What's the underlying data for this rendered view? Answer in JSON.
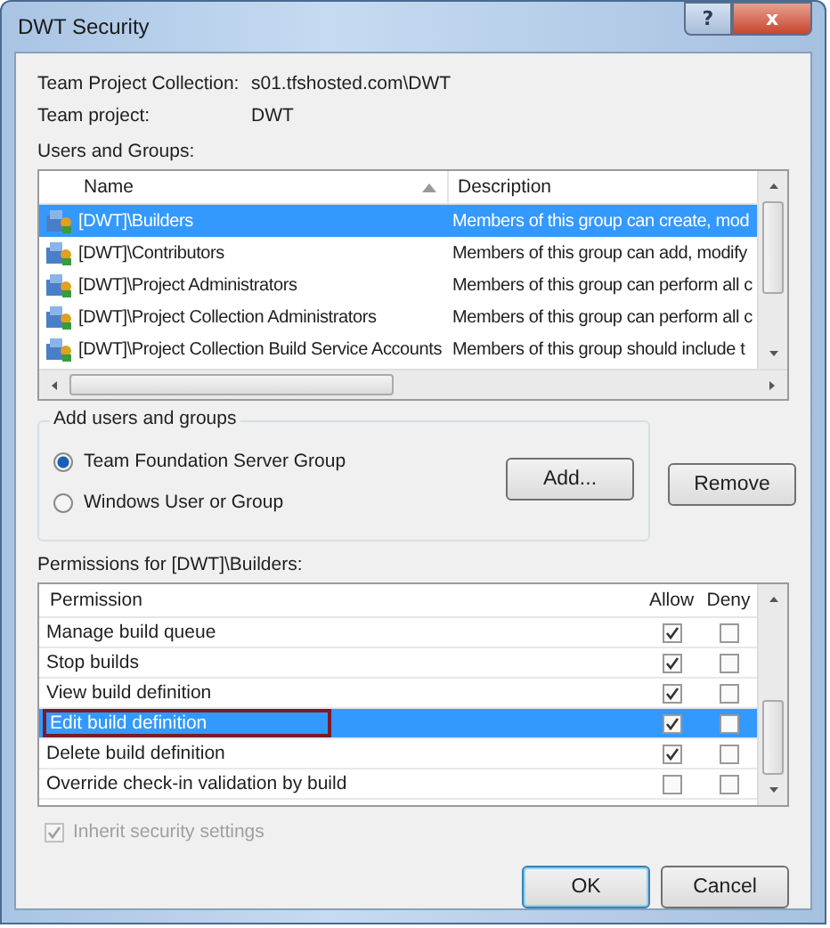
{
  "window": {
    "title": "DWT Security",
    "help_glyph": "?",
    "close_glyph": "x"
  },
  "info": [
    {
      "label": "Team Project Collection:",
      "value": "s01.tfshosted.com\\DWT"
    },
    {
      "label": "Team project:",
      "value": "DWT"
    }
  ],
  "users_label": "Users and Groups:",
  "users": {
    "columns": [
      "Name",
      "Description"
    ],
    "rows": [
      {
        "name": "[DWT]\\Builders",
        "description": "Members of this group can create, mod",
        "selected": true
      },
      {
        "name": "[DWT]\\Contributors",
        "description": "Members of this group can add, modify",
        "selected": false
      },
      {
        "name": "[DWT]\\Project Administrators",
        "description": "Members of this group can perform all c",
        "selected": false
      },
      {
        "name": "[DWT]\\Project Collection Administrators",
        "description": "Members of this group can perform all c",
        "selected": false
      },
      {
        "name": "[DWT]\\Project Collection Build Service Accounts",
        "description": "Members of this group should include t",
        "selected": false
      }
    ]
  },
  "add_group": {
    "title": "Add users and groups",
    "options": [
      {
        "label": "Team Foundation Server Group",
        "selected": true
      },
      {
        "label": "Windows User or Group",
        "selected": false
      }
    ],
    "buttons": [
      "Add...",
      "Remove"
    ]
  },
  "permissions_label": "Permissions for [DWT]\\Builders:",
  "permissions": {
    "columns": [
      "Permission",
      "Allow",
      "Deny"
    ],
    "rows": [
      {
        "name": "Manage build queue",
        "allow": true,
        "deny": false,
        "selected": false,
        "outlined": false
      },
      {
        "name": "Stop builds",
        "allow": true,
        "deny": false,
        "selected": false,
        "outlined": false
      },
      {
        "name": "View build definition",
        "allow": true,
        "deny": false,
        "selected": false,
        "outlined": false
      },
      {
        "name": "Edit build definition",
        "allow": true,
        "deny": false,
        "selected": true,
        "outlined": true
      },
      {
        "name": "Delete build definition",
        "allow": true,
        "deny": false,
        "selected": false,
        "outlined": false
      },
      {
        "name": "Override check-in validation by build",
        "allow": false,
        "deny": false,
        "selected": false,
        "outlined": false
      }
    ]
  },
  "inherit": {
    "label": "Inherit security settings",
    "checked": true,
    "disabled": true
  },
  "buttons": [
    {
      "label": "OK",
      "default": true
    },
    {
      "label": "Cancel",
      "default": false
    }
  ]
}
